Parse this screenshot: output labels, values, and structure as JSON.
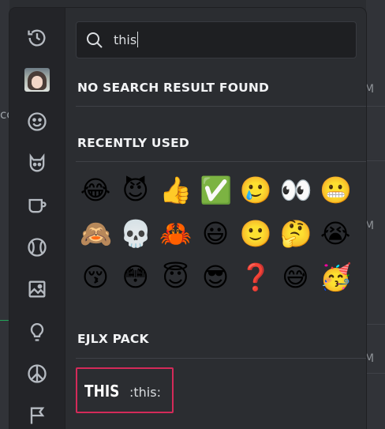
{
  "search": {
    "query": "this"
  },
  "sections": {
    "no_result": "NO SEARCH RESULT FOUND",
    "recent": "RECENTLY USED",
    "pack": "EJLX PACK"
  },
  "recent_emojis": [
    "😂",
    "😈",
    "👍",
    "✅",
    "🥲",
    "👀",
    "😬",
    "🙈",
    "💀",
    "🦀",
    "😃",
    "🙂",
    "🤔",
    "😭",
    "😚",
    "😳",
    "😇",
    "😎",
    "❓",
    "😅",
    "🥳"
  ],
  "pack_item": {
    "sticker_text": "THIS",
    "code": ":this:"
  },
  "rail": {
    "icons": [
      "clock-icon",
      "avatar",
      "smile-icon",
      "cat-icon",
      "cup-icon",
      "ball-icon",
      "image-icon",
      "bulb-icon",
      "peace-icon",
      "flag-icon"
    ]
  },
  "background": {
    "left_text": "cc",
    "right_letter": "M"
  },
  "colors": {
    "highlight": "#d42a59",
    "background": "#2b2d31",
    "rail": "#232428"
  }
}
